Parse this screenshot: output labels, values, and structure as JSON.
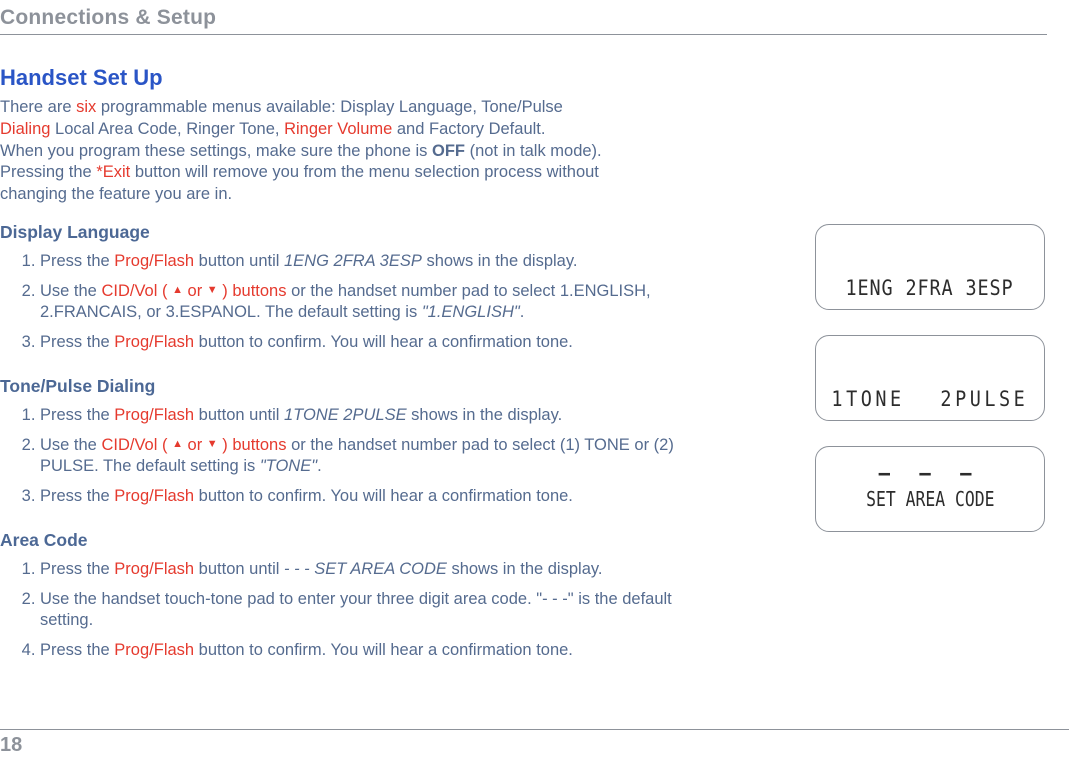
{
  "section_title": "Connections & Setup",
  "h2": "Handset Set Up",
  "intro": {
    "l1a": "There are ",
    "l1_hl": "six",
    "l1b": " programmable menus available: Display Language, Tone/Pulse",
    "l2a": "Dialing",
    "l2b": " Local Area Code, Ringer Tone, ",
    "l2_hl": "Ringer Volume",
    "l2c": " and Factory Default.",
    "l3a": "When you program these settings, make sure the phone is ",
    "l3_off": "OFF",
    "l3b": " (not in talk mode).",
    "l4a": "Pressing the ",
    "l4_hl": "*Exit",
    "l4b": " button will remove you from the menu selection process without",
    "l5": "changing the feature you are in."
  },
  "display_language": {
    "heading": "Display Language",
    "s1a": "Press the ",
    "s1_hl": "Prog/Flash",
    "s1b": " button until ",
    "s1_it": "1ENG 2FRA 3ESP",
    "s1c": " shows in the display.",
    "s2a": "Use the ",
    "s2_hl": "CID/Vol ( ",
    "s2_or": " or ",
    "s2_hl2": " ) buttons",
    "s2b": " or the handset number pad to select 1.ENGLISH, 2.FRANCAIS, or 3.ESPANOL. The default setting is ",
    "s2_it": "\"1.ENGLISH\"",
    "s2c": ".",
    "s3a": "Press the ",
    "s3_hl": "Prog/Flash",
    "s3b": " button to confirm. You will hear a confirmation tone."
  },
  "tone_pulse": {
    "heading": "Tone/Pulse Dialing",
    "s1a": "Press the ",
    "s1_hl": "Prog/Flash",
    "s1b": " button until ",
    "s1_it": "1TONE 2PULSE",
    "s1c": " shows in the display.",
    "s2a": "Use the ",
    "s2_hl": "CID/Vol ( ",
    "s2_or": " or ",
    "s2_hl2": " ) buttons",
    "s2b": " or the handset number pad to select (1) TONE or (2) PULSE. The default setting is ",
    "s2_it": "\"TONE\"",
    "s2c": ".",
    "s3a": "Press the ",
    "s3_hl": "Prog/Flash",
    "s3b": " button to confirm. You will hear a confirmation tone."
  },
  "area_code": {
    "heading": "Area Code",
    "s1a": "Press the ",
    "s1_hl": "Prog/Flash",
    "s1b": " button until ",
    "s1_it": "- - - SET AREA CODE",
    "s1c": " shows in the display.",
    "s2": "Use the handset touch-tone pad to enter your three digit area code. \"- - -\"  is the default setting.",
    "s4a": "Press the ",
    "s4_hl": "Prog/Flash",
    "s4b": " button to confirm. You will hear a confirmation tone."
  },
  "lcd": {
    "d1": "1ENG  2FRA  3ESP",
    "d2": "1TONE 2PULSE",
    "d3_top": "– – –",
    "d3_bot": "SET AREA CODE"
  },
  "page_number": "18",
  "arrows": {
    "up": "▲",
    "down": "▼"
  }
}
